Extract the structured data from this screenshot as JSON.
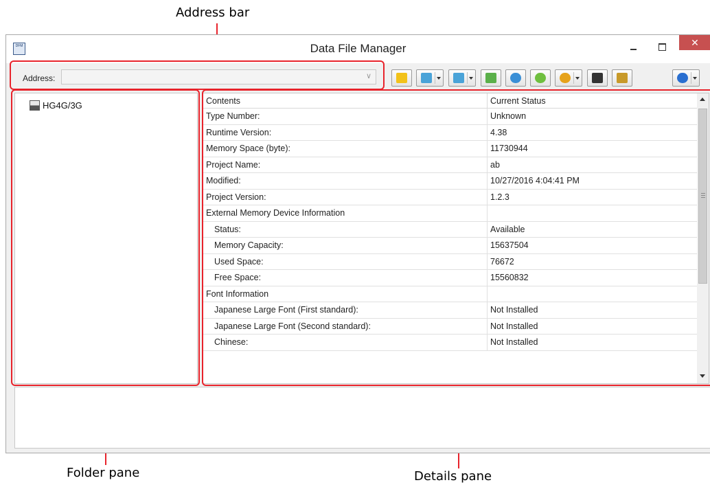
{
  "callouts": {
    "address_bar": "Address bar",
    "folder_pane": "Folder pane",
    "details_pane": "Details pane"
  },
  "window": {
    "title": "Data File Manager",
    "app_icon_text": "DFM",
    "close_glyph": "✕"
  },
  "address": {
    "label": "Address:",
    "value": "",
    "chevron": "∨"
  },
  "toolbar": {
    "buttons": [
      {
        "icon": "connect-icon",
        "color": "#f2c21a"
      },
      {
        "icon": "download-icon",
        "color": "#4aa3d8"
      },
      {
        "icon": "upload-icon",
        "color": "#4aa3d8"
      },
      {
        "icon": "transfer-icon",
        "color": "#5bb04a"
      },
      {
        "icon": "import-icon",
        "color": "#3a8fd6"
      },
      {
        "icon": "export-icon",
        "color": "#6fbf3f"
      },
      {
        "icon": "memory-card-icon",
        "color": "#e6a21a"
      },
      {
        "icon": "device-check-icon",
        "color": "#333333"
      },
      {
        "icon": "report-icon",
        "color": "#c89a2a"
      },
      {
        "icon": "help-icon",
        "color": "#2a6fd0"
      }
    ]
  },
  "folder_pane": {
    "items": [
      {
        "label": "HG4G/3G",
        "icon": "device-icon"
      }
    ]
  },
  "details": {
    "columns": [
      "Contents",
      "Current Status"
    ],
    "rows": [
      {
        "content": "Type Number:",
        "status": "Unknown",
        "indent": false
      },
      {
        "content": "Runtime Version:",
        "status": "4.38",
        "indent": false
      },
      {
        "content": "Memory Space (byte):",
        "status": "11730944",
        "indent": false
      },
      {
        "content": "Project Name:",
        "status": "ab",
        "indent": false
      },
      {
        "content": "Modified:",
        "status": "10/27/2016 4:04:41 PM",
        "indent": false
      },
      {
        "content": "Project Version:",
        "status": "1.2.3",
        "indent": false
      },
      {
        "content": "External Memory Device Information",
        "status": "",
        "indent": false
      },
      {
        "content": "Status:",
        "status": "Available",
        "indent": true
      },
      {
        "content": "Memory Capacity:",
        "status": "15637504",
        "indent": true
      },
      {
        "content": "Used Space:",
        "status": "76672",
        "indent": true
      },
      {
        "content": "Free Space:",
        "status": "15560832",
        "indent": true
      },
      {
        "content": "Font Information",
        "status": "",
        "indent": false
      },
      {
        "content": "Japanese Large Font (First standard):",
        "status": "Not Installed",
        "indent": true
      },
      {
        "content": "Japanese Large Font (Second standard):",
        "status": "Not Installed",
        "indent": true
      },
      {
        "content": "Chinese:",
        "status": "Not Installed",
        "indent": true
      }
    ]
  },
  "colors": {
    "callout": "#e8232b",
    "close_button": "#c75050"
  }
}
